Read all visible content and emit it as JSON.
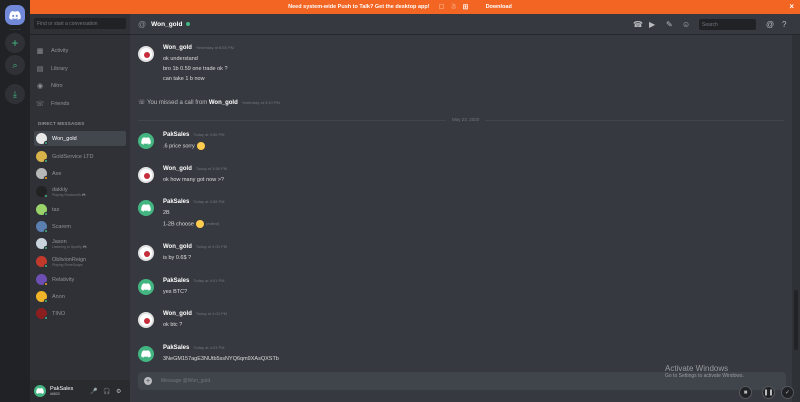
{
  "banner": {
    "text": "Need system-wide Push to Talk? Get the desktop app!",
    "download": "Download",
    "close": "×"
  },
  "rail": {
    "add_icon": "+",
    "explore_icon": "⌕",
    "download_icon": "⤓"
  },
  "sidebar": {
    "search_placeholder": "Find or start a conversation",
    "nav": [
      {
        "label": "Activity",
        "icon": "activity-icon"
      },
      {
        "label": "Library",
        "icon": "library-icon"
      },
      {
        "label": "Nitro",
        "icon": "nitro-icon"
      },
      {
        "label": "Friends",
        "icon": "friends-icon"
      }
    ],
    "dm_header": "DIRECT MESSAGES",
    "dms": [
      {
        "name": "Won_gold",
        "sub": "",
        "color": "#e8e8e8",
        "status": "#43b581"
      },
      {
        "name": "GoldService LTD",
        "sub": "",
        "color": "#d7b34a",
        "status": "#43b581"
      },
      {
        "name": "Axe",
        "sub": "",
        "color": "#b7b7b7",
        "status": "#faa61a"
      },
      {
        "name": "dakkly",
        "sub": "Playing Rocksmith 🎮",
        "color": "#222222",
        "status": "#43b581"
      },
      {
        "name": "tax",
        "sub": "",
        "color": "#9ad36a",
        "status": "#43b581"
      },
      {
        "name": "Scarem",
        "sub": "",
        "color": "#5a7fb0",
        "status": "#43b581"
      },
      {
        "name": "Jason",
        "sub": "Listening to Spotify 🎮",
        "color": "#c9d4dd",
        "status": "#43b581"
      },
      {
        "name": "OblivionReign",
        "sub": "Playing RuneScape",
        "color": "#c0392b",
        "status": "#43b581"
      },
      {
        "name": "Relativity",
        "sub": "",
        "color": "#6d4fb3",
        "status": "#faa61a"
      },
      {
        "name": "Anon",
        "sub": "",
        "color": "#f0b429",
        "status": "#43b581"
      },
      {
        "name": "TINO",
        "sub": "",
        "color": "#8b1e1e",
        "status": "#43b581"
      }
    ],
    "user": {
      "name": "PakSales",
      "tag": "#6820",
      "mic": "🎤",
      "headset": "🎧",
      "settings": "⚙"
    }
  },
  "header": {
    "title": "Won_gold",
    "search_placeholder": "Search"
  },
  "messages": {
    "first": {
      "author": "Won_gold",
      "time": "Yesterday at 8:55 PM",
      "lines": [
        "ok understand",
        "bro 1b 0.59 one  trade ok ?",
        "can  take 1 b now"
      ]
    },
    "missed": {
      "text": "You missed a call from",
      "who": "Won_gold",
      "time": "Yesterday at 9:10 PM"
    },
    "date_divider": "May 23, 2020",
    "list": [
      {
        "author": "PakSales",
        "time": "Today at 3:56 PM",
        "avatar": "pak",
        "lines": [
          ".6 price sorry"
        ],
        "emoji": true
      },
      {
        "author": "Won_gold",
        "time": "Today at 3:56 PM",
        "avatar": "won",
        "lines": [
          "ok how many got now >?"
        ],
        "emoji": false
      },
      {
        "author": "PakSales",
        "time": "Today at 3:58 PM",
        "avatar": "pak",
        "lines": [
          "2B",
          "1-2B choose"
        ],
        "emoji": false,
        "emoji_line2": true,
        "edited": "(edited)"
      },
      {
        "author": "Won_gold",
        "time": "Today at 4:00 PM",
        "avatar": "won",
        "lines": [
          "is by 0.6$ ?"
        ],
        "emoji": false
      },
      {
        "author": "PakSales",
        "time": "Today at 4:01 PM",
        "avatar": "pak",
        "lines": [
          "yes BTC?"
        ],
        "emoji": false
      },
      {
        "author": "Won_gold",
        "time": "Today at 4:03 PM",
        "avatar": "won",
        "lines": [
          "ok btc ?"
        ],
        "emoji": false
      },
      {
        "author": "PakSales",
        "time": "Today at 4:03 PM",
        "avatar": "pak",
        "lines": [
          "3NeGM157agE3NUtb5ssNYQ6qm9XAsQXSTb"
        ],
        "emoji": false
      }
    ]
  },
  "composer": {
    "placeholder": "Message @Won_gold"
  },
  "watermark": {
    "title": "Activate Windows",
    "sub": "Go to Settings to activate Windows."
  },
  "colors": {
    "accent": "#7289da",
    "online": "#43b581",
    "banner": "#f26522"
  }
}
